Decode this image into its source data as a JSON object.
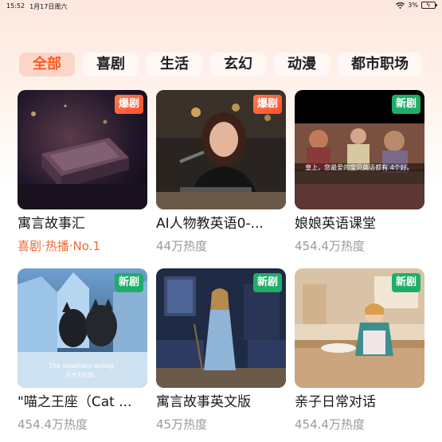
{
  "status_bar": {
    "time": "15:52",
    "date": "1月17日周六",
    "battery": "3%"
  },
  "tabs": [
    {
      "label": "全部",
      "active": true
    },
    {
      "label": "喜剧",
      "active": false
    },
    {
      "label": "生活",
      "active": false
    },
    {
      "label": "玄幻",
      "active": false
    },
    {
      "label": "动漫",
      "active": false
    },
    {
      "label": "都市职场",
      "active": false
    }
  ],
  "cards": [
    {
      "title": "寓言故事汇",
      "badge": "爆剧",
      "meta": "喜剧·热播·No.1"
    },
    {
      "title": "AI人物教英语0-...",
      "badge": "爆剧",
      "meta": "44万热度"
    },
    {
      "title": "娘娘英语课堂",
      "badge": "新剧",
      "meta": "454.4万热度",
      "subtitle": "皇上，您最爱的宝贝英语都有 4个好。"
    },
    {
      "title": "\"喵之王座（Cat ...",
      "badge": "新剧",
      "meta": "454.4万热度",
      "subtitle_en": "The weathers wrong.",
      "subtitle_zh": "天气不对劲。"
    },
    {
      "title": "寓言故事英文版",
      "badge": "新剧",
      "meta": "45万热度"
    },
    {
      "title": "亲子日常对话",
      "badge": "新剧",
      "meta": "454.4万热度"
    }
  ]
}
